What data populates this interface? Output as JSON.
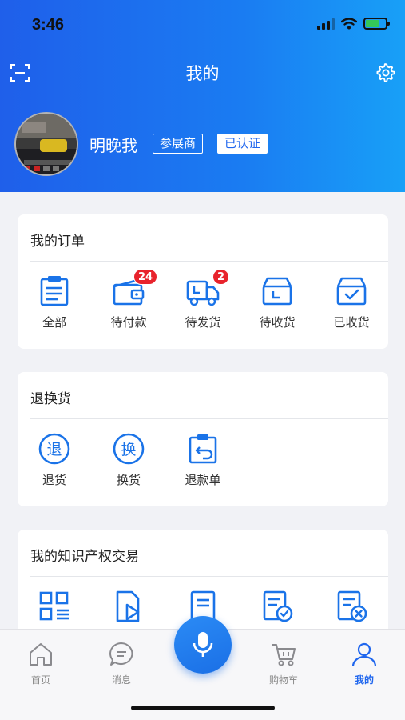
{
  "status_bar": {
    "time": "3:46"
  },
  "header": {
    "title": "我的",
    "username": "明晚我",
    "role_badge": "参展商",
    "verified_badge": "已认证"
  },
  "orders": {
    "title": "我的订单",
    "items": [
      {
        "label": "全部",
        "icon": "clipboard-icon"
      },
      {
        "label": "待付款",
        "icon": "wallet-icon",
        "badge": "24"
      },
      {
        "label": "待发货",
        "icon": "truck-icon",
        "badge": "2"
      },
      {
        "label": "待收货",
        "icon": "inbox-icon"
      },
      {
        "label": "已收货",
        "icon": "box-check-icon"
      }
    ]
  },
  "returns": {
    "title": "退换货",
    "items": [
      {
        "label": "退货",
        "icon": "return-circle-icon",
        "glyph": "退"
      },
      {
        "label": "换货",
        "icon": "exchange-circle-icon",
        "glyph": "换"
      },
      {
        "label": "退款单",
        "icon": "refund-clipboard-icon"
      }
    ]
  },
  "ip_trade": {
    "title": "我的知识产权交易",
    "items": [
      {
        "icon": "grid-list-icon"
      },
      {
        "icon": "doc-play-icon"
      },
      {
        "icon": "doc-list-icon"
      },
      {
        "icon": "doc-check-icon"
      },
      {
        "icon": "doc-cancel-icon"
      }
    ]
  },
  "tabbar": {
    "items": [
      {
        "label": "首页",
        "icon": "home-icon"
      },
      {
        "label": "消息",
        "icon": "message-icon"
      },
      {
        "label": "购物车",
        "icon": "cart-icon"
      },
      {
        "label": "我的",
        "icon": "user-icon",
        "active": true
      }
    ],
    "voice_icon": "microphone-icon"
  },
  "colors": {
    "brand": "#1f66ee",
    "badge_red": "#e8232c",
    "icon_blue": "#1a73e8"
  }
}
